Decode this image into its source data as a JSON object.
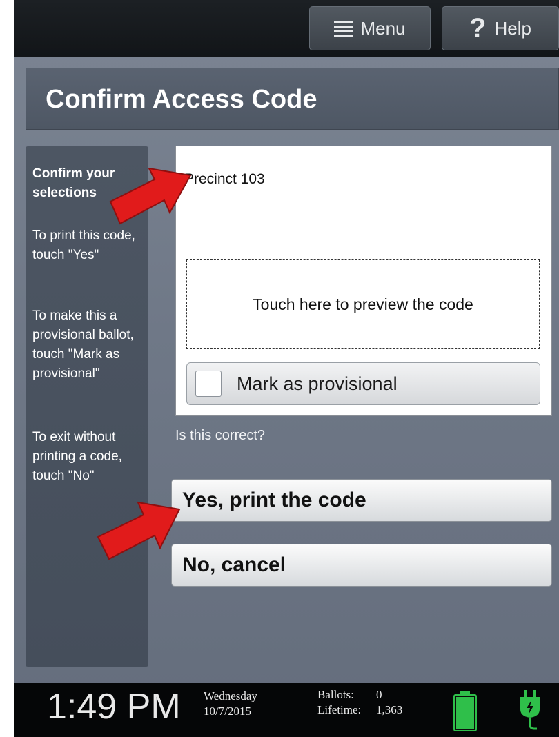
{
  "topbar": {
    "menu_label": "Menu",
    "help_label": "Help",
    "menu_icon": "hamburger-icon",
    "help_icon": "question-icon"
  },
  "page": {
    "title": "Confirm Access Code"
  },
  "sidebar": {
    "heading": "Confirm your selections",
    "instruction_print": "To print this code, touch \"Yes\"",
    "instruction_provisional": "To make this a provisional ballot, touch \"Mark as provisional\"",
    "instruction_exit": "To exit without printing a code, touch \"No\""
  },
  "panel": {
    "precinct": "Precinct 103",
    "preview_prompt": "Touch here to preview the code",
    "provisional_label": "Mark as provisional",
    "provisional_checked": false
  },
  "confirm": {
    "question": "Is this correct?",
    "yes_label": "Yes, print the code",
    "no_label": "No, cancel"
  },
  "status": {
    "time": "1:49 PM",
    "day": "Wednesday",
    "date": "10/7/2015",
    "ballots_label": "Ballots:",
    "ballots_value": "0",
    "lifetime_label": "Lifetime:",
    "lifetime_value": "1,363",
    "battery_icon": "battery-full-icon",
    "power_icon": "power-plug-icon"
  },
  "colors": {
    "accent_green": "#2fbf4a",
    "arrow_red": "#e11b1b"
  }
}
